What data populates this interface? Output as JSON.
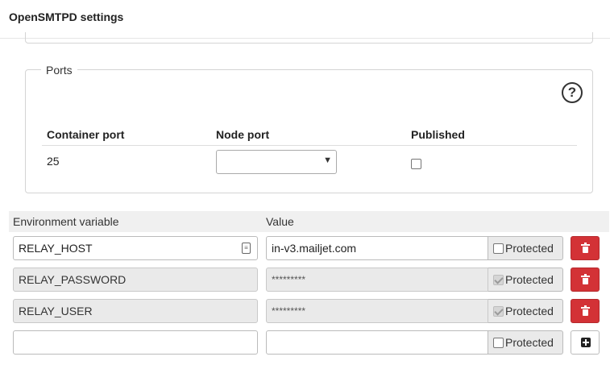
{
  "header": {
    "title": "OpenSMTPD settings"
  },
  "ports": {
    "legend": "Ports",
    "help_icon": "question-circle-icon",
    "columns": {
      "container_port": "Container port",
      "node_port": "Node port",
      "published": "Published"
    },
    "rows": [
      {
        "container_port": "25",
        "node_port": "",
        "published": false
      }
    ]
  },
  "env": {
    "columns": {
      "name": "Environment variable",
      "value": "Value"
    },
    "protected_label": "Protected",
    "rows": [
      {
        "name": "RELAY_HOST",
        "value": "in-v3.mailjet.com",
        "protected": false,
        "editable": true
      },
      {
        "name": "RELAY_PASSWORD",
        "value": "*********",
        "protected": true,
        "editable": false
      },
      {
        "name": "RELAY_USER",
        "value": "*********",
        "protected": true,
        "editable": false
      }
    ],
    "new_row": {
      "name": "",
      "value": "",
      "protected": false
    },
    "colors": {
      "delete_button": "#d33236"
    }
  }
}
